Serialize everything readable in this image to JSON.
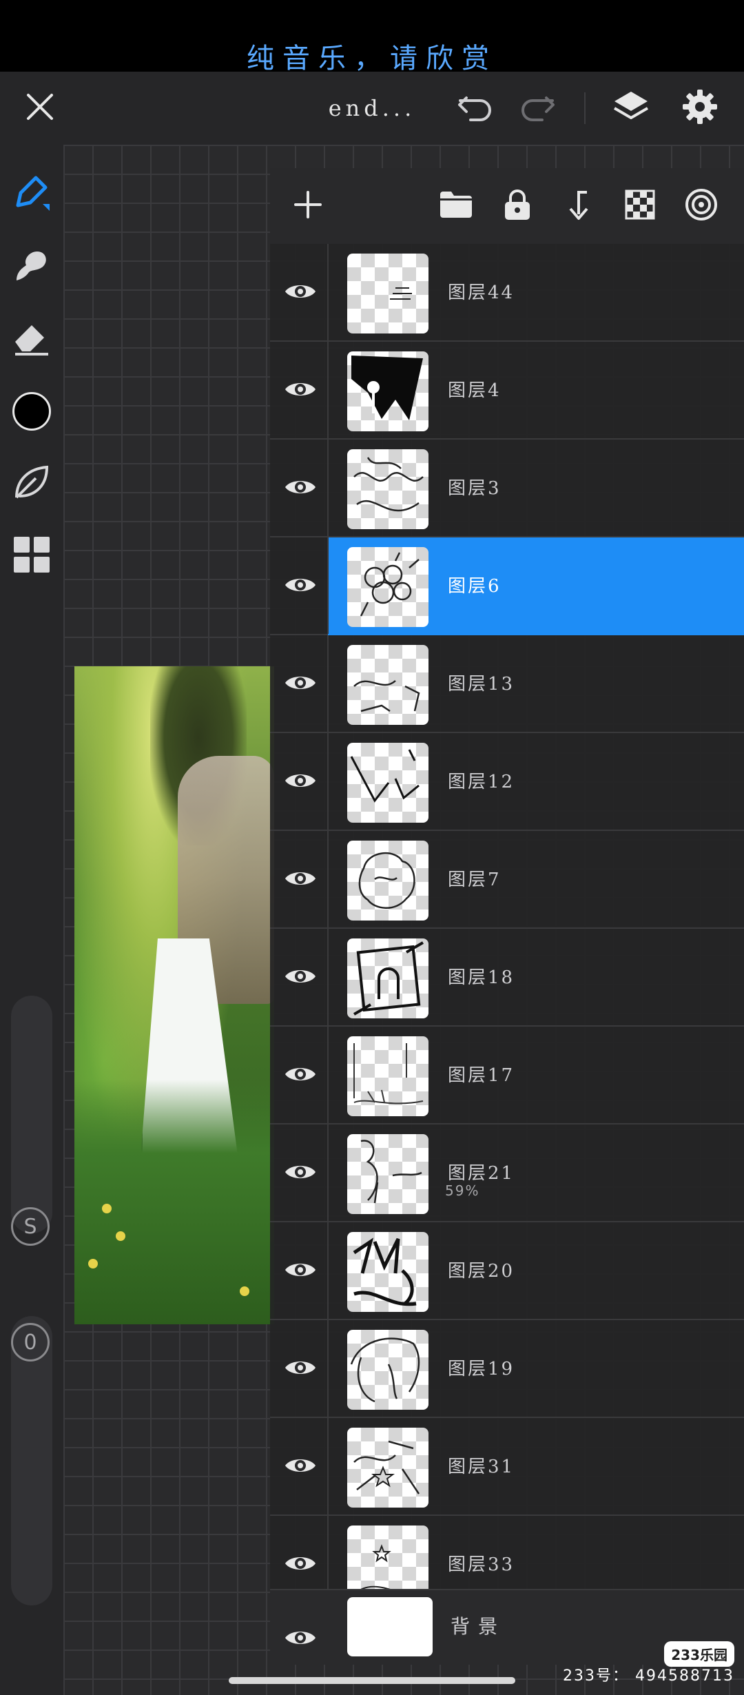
{
  "banner": {
    "text": "纯音乐，请欣赏"
  },
  "toolbar": {
    "title": "end...",
    "close_icon": "close-icon",
    "undo_icon": "undo-icon",
    "redo_icon": "redo-icon",
    "layers_icon": "layers-icon",
    "settings_icon": "gear-icon"
  },
  "tools": [
    {
      "name": "pen-tool",
      "icon": "pen-icon",
      "active": true
    },
    {
      "name": "smudge-tool",
      "icon": "smudge-icon"
    },
    {
      "name": "eraser-tool",
      "icon": "eraser-icon"
    },
    {
      "name": "color-picker",
      "icon": "color-swatch",
      "color": "#000000"
    },
    {
      "name": "leaf-brush-tool",
      "icon": "leaf-icon"
    },
    {
      "name": "gallery-tool",
      "icon": "grid-icon"
    }
  ],
  "sliders": {
    "size_label": "S",
    "opacity_label": "0"
  },
  "layers_panel": {
    "header_icons": [
      "add-icon",
      "folder-icon",
      "lock-icon",
      "merge-down-icon",
      "transparency-icon",
      "target-icon"
    ],
    "layers": [
      {
        "name": "图层44",
        "opacity": "",
        "selected": false
      },
      {
        "name": "图层4",
        "opacity": "",
        "selected": false
      },
      {
        "name": "图层3",
        "opacity": "",
        "selected": false
      },
      {
        "name": "图层6",
        "opacity": "",
        "selected": true
      },
      {
        "name": "图层13",
        "opacity": "",
        "selected": false
      },
      {
        "name": "图层12",
        "opacity": "",
        "selected": false
      },
      {
        "name": "图层7",
        "opacity": "",
        "selected": false
      },
      {
        "name": "图层18",
        "opacity": "",
        "selected": false
      },
      {
        "name": "图层17",
        "opacity": "",
        "selected": false
      },
      {
        "name": "图层21",
        "opacity": "59%",
        "selected": false
      },
      {
        "name": "图层20",
        "opacity": "",
        "selected": false
      },
      {
        "name": "图层19",
        "opacity": "",
        "selected": false
      },
      {
        "name": "图层31",
        "opacity": "",
        "selected": false
      },
      {
        "name": "图层33",
        "opacity": "",
        "selected": false
      }
    ],
    "background_layer": {
      "name": "背景"
    }
  },
  "watermark": {
    "logo": "233乐园",
    "id_text": "233号： 494588713"
  },
  "colors": {
    "accent": "#1e8df6",
    "selected_row": "#1e8df6",
    "panel": "#29292b",
    "banner_text": "#5aa9ff"
  }
}
